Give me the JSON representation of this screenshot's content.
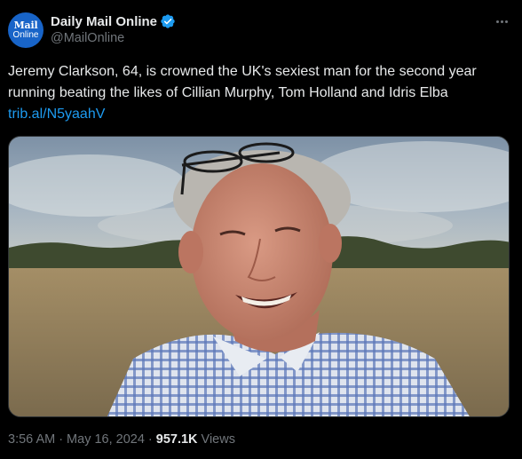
{
  "author": {
    "avatar_text_line1": "Mail",
    "avatar_text_line2": "Online",
    "display_name": "Daily Mail Online",
    "handle": "@MailOnline",
    "verified_icon": "verified-badge-icon",
    "avatar_color": "#1864c8",
    "verified_color": "#1d9bf0"
  },
  "tweet": {
    "text": "Jeremy Clarkson, 64, is crowned the UK's sexiest man for the second year running beating the likes of Cillian Murphy, Tom Holland and Idris Elba",
    "link": "trib.al/N5yaahV"
  },
  "meta": {
    "time": "3:56 AM",
    "separator1": "·",
    "date": "May 16, 2024",
    "separator2": "·",
    "views_count": "957.1K",
    "views_label": "Views"
  },
  "colors": {
    "background": "#000000",
    "text_primary": "#e7e9ea",
    "text_secondary": "#71767b",
    "link": "#1d9bf0"
  }
}
